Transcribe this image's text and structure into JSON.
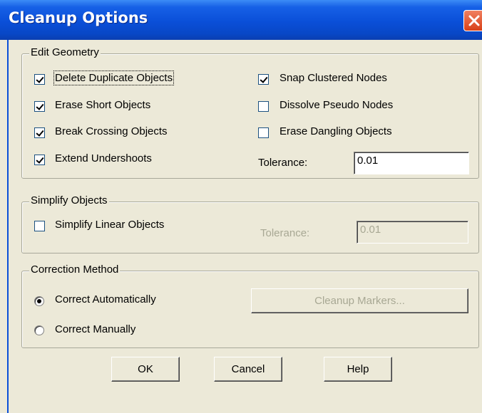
{
  "window": {
    "title": "Cleanup Options"
  },
  "edit_geometry": {
    "label": "Edit Geometry",
    "delete_duplicate": {
      "label": "Delete Duplicate Objects",
      "checked": true
    },
    "erase_short": {
      "label": "Erase Short Objects",
      "checked": true
    },
    "break_crossing": {
      "label": "Break Crossing Objects",
      "checked": true
    },
    "extend_undershoots": {
      "label": "Extend Undershoots",
      "checked": true
    },
    "snap_clustered": {
      "label": "Snap Clustered Nodes",
      "checked": true
    },
    "dissolve_pseudo": {
      "label": "Dissolve Pseudo Nodes",
      "checked": false
    },
    "erase_dangling": {
      "label": "Erase Dangling Objects",
      "checked": false
    },
    "tolerance_label": "Tolerance:",
    "tolerance_value": "0.01"
  },
  "simplify_objects": {
    "label": "Simplify Objects",
    "simplify_linear": {
      "label": "Simplify Linear Objects",
      "checked": false
    },
    "tolerance_label": "Tolerance:",
    "tolerance_value": "0.01"
  },
  "correction_method": {
    "label": "Correction Method",
    "auto_label": "Correct Automatically",
    "manual_label": "Correct Manually",
    "selected": "Correct Automatically",
    "markers_button": "Cleanup Markers..."
  },
  "buttons": {
    "ok": "OK",
    "cancel": "Cancel",
    "help": "Help"
  }
}
